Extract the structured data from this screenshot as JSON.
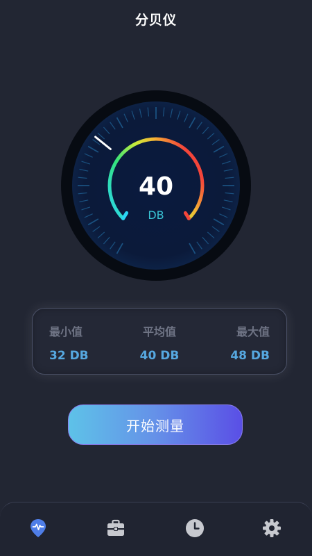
{
  "header": {
    "title": "分贝仪"
  },
  "gauge": {
    "value": "40",
    "unit": "DB",
    "level_fraction": 0.31
  },
  "stats": {
    "min": {
      "label": "最小值",
      "value": "32 DB"
    },
    "avg": {
      "label": "平均值",
      "value": "40 DB"
    },
    "max": {
      "label": "最大值",
      "value": "48 DB"
    }
  },
  "actions": {
    "start_label": "开始测量"
  },
  "nav": {
    "items": [
      {
        "icon": "heartbeat-location-icon",
        "active": true
      },
      {
        "icon": "toolbox-icon",
        "active": false
      },
      {
        "icon": "clock-icon",
        "active": false
      },
      {
        "icon": "gear-icon",
        "active": false
      }
    ]
  },
  "colors": {
    "accent_blue": "#56a8e0",
    "unit_cyan": "#39c3d4",
    "nav_active": "#4f7ee8",
    "nav_inactive": "#c7c9cf"
  }
}
